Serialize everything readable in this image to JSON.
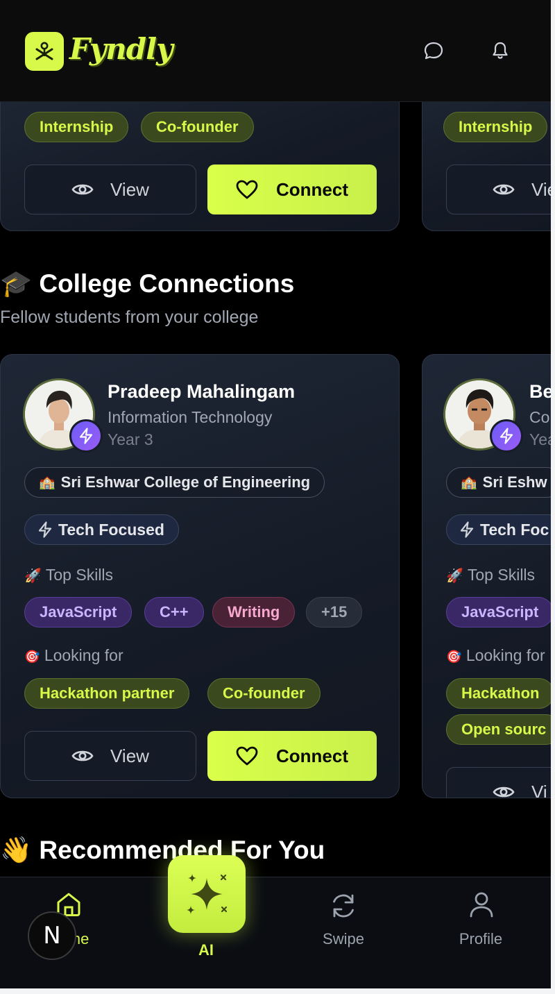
{
  "header": {
    "brand": "Fyndly"
  },
  "top_cards": [
    {
      "looking_for": [
        "Internship",
        "Co-founder"
      ],
      "view_label": "View",
      "connect_label": "Connect"
    },
    {
      "looking_for": [
        "Internship"
      ],
      "view_label": "View"
    }
  ],
  "college_section": {
    "emoji": "🎓",
    "title": "College Connections",
    "subtitle": "Fellow students from your college",
    "cards": [
      {
        "name": "Pradeep Mahalingam",
        "department": "Information Technology",
        "year": "Year 3",
        "college": "Sri Eshwar College of Engineering",
        "college_emoji": "🏫",
        "tag": "Tech Focused",
        "skills_label": "Top Skills",
        "skills_emoji": "🚀",
        "skills": [
          "JavaScript",
          "C++",
          "Writing",
          "+15"
        ],
        "looking_label": "Looking for",
        "looking_emoji": "🎯",
        "looking_for": [
          "Hackathon partner",
          "Co-founder"
        ],
        "view_label": "View",
        "connect_label": "Connect"
      },
      {
        "name": "Be",
        "department": "Co",
        "year": "Yea",
        "college": "Sri Eshw",
        "college_emoji": "🏫",
        "tag": "Tech Foc",
        "skills_label": "Top Skills",
        "skills_emoji": "🚀",
        "skills": [
          "JavaScript"
        ],
        "looking_label": "Looking for",
        "looking_emoji": "🎯",
        "looking_for": [
          "Hackathon",
          "Open sourc"
        ],
        "view_label": "Vi"
      }
    ]
  },
  "recommended_section": {
    "emoji": "👋",
    "title": "Recommended For You"
  },
  "nav": {
    "home": "Home",
    "ai": "AI",
    "swipe": "Swipe",
    "profile": "Profile",
    "overlay_letter": "N"
  },
  "colors": {
    "accent": "#d8f84a",
    "background": "#000000",
    "card": "#1a2130"
  }
}
